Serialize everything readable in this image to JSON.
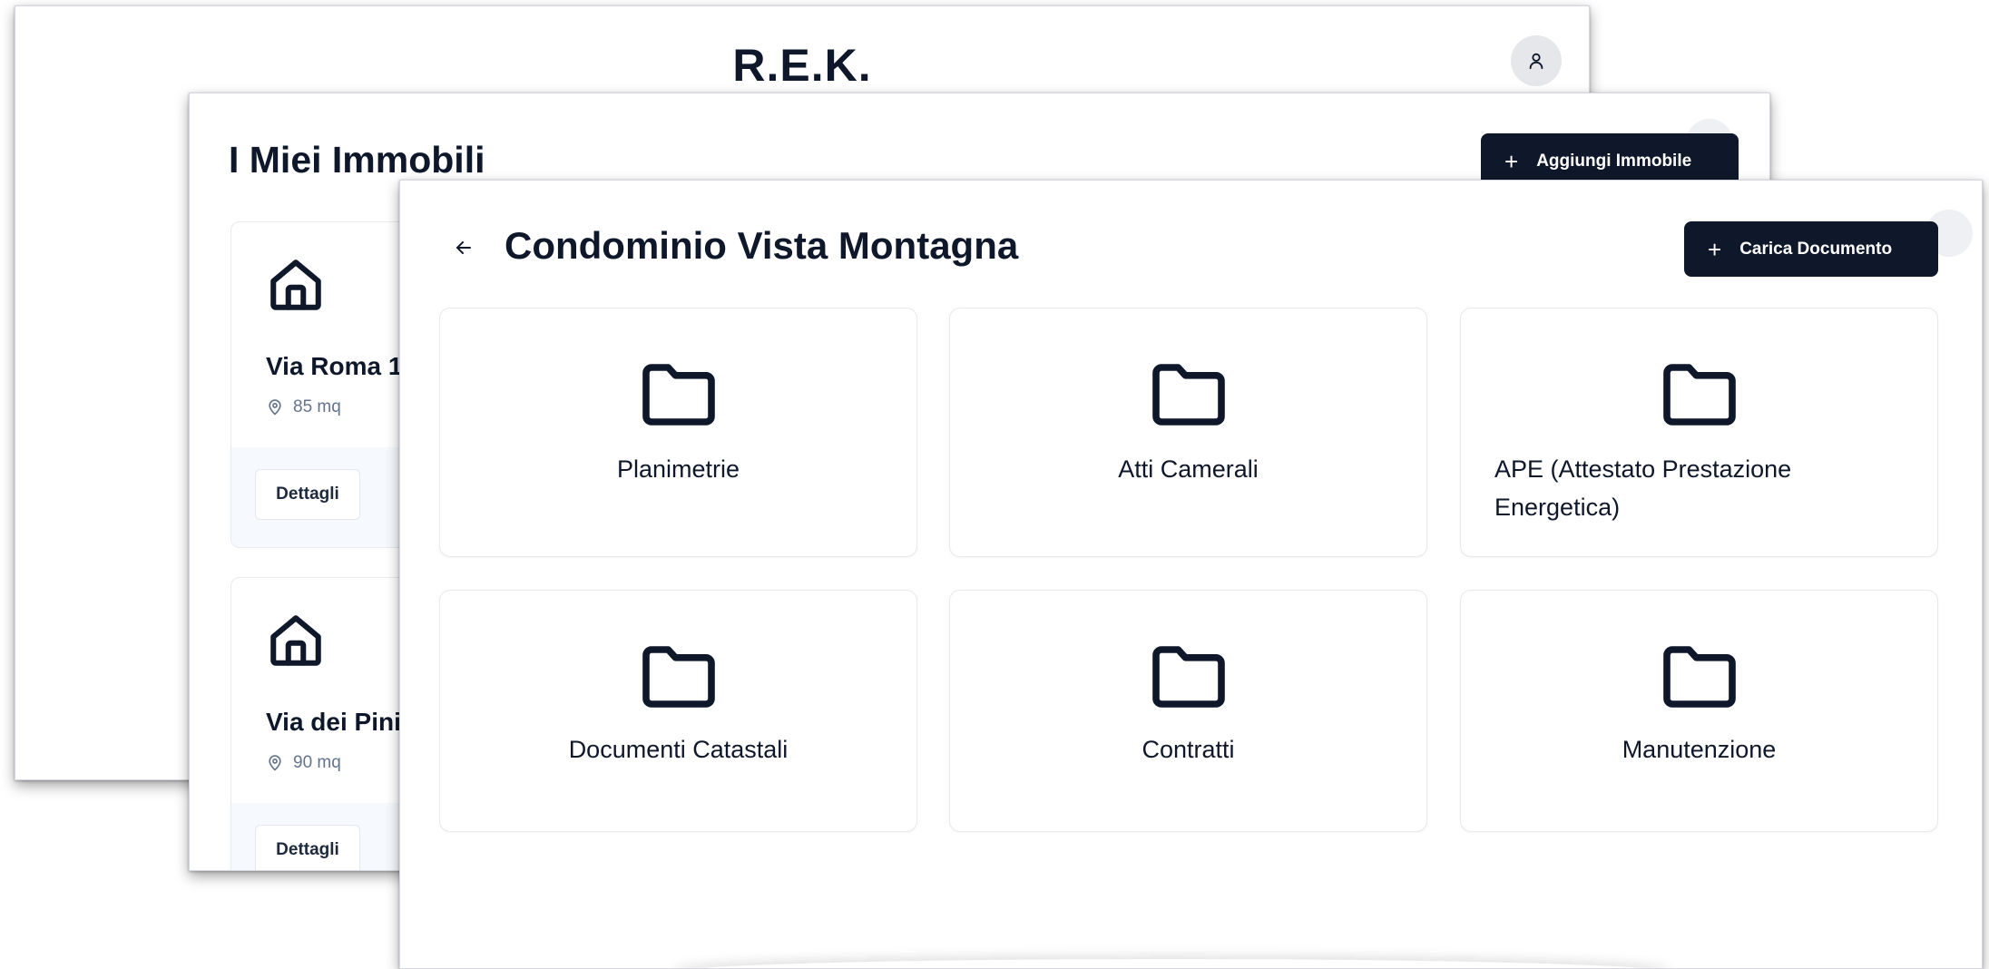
{
  "app": {
    "brand": "R.E.K."
  },
  "properties_view": {
    "title": "I Miei Immobili",
    "add_button_label": "Aggiungi Immobile",
    "add_button_icon": "plus-icon",
    "properties": [
      {
        "name": "Via Roma 1",
        "size": "85 mq",
        "details_label": "Dettagli",
        "icon": "home-icon"
      },
      {
        "name": "Via dei Pini",
        "size": "90 mq",
        "details_label": "Dettagli",
        "icon": "home-icon"
      }
    ]
  },
  "folder_view": {
    "title": "Condominio Vista Montagna",
    "back_icon": "arrow-left-icon",
    "upload_button_label": "Carica Documento",
    "upload_button_icon": "plus-icon",
    "folders": [
      {
        "label": "Planimetrie",
        "icon": "folder-icon"
      },
      {
        "label": "Atti Camerali",
        "icon": "folder-icon"
      },
      {
        "label": "APE (Attestato Prestazione Energetica)",
        "icon": "folder-icon"
      },
      {
        "label": "Documenti Catastali",
        "icon": "folder-icon"
      },
      {
        "label": "Contratti",
        "icon": "folder-icon"
      },
      {
        "label": "Manutenzione",
        "icon": "folder-icon"
      }
    ]
  },
  "colors": {
    "primary": "#0f172a",
    "muted_text": "#64748b",
    "card_border": "#e6e9ee",
    "footer_bg": "#f6f9fd"
  }
}
